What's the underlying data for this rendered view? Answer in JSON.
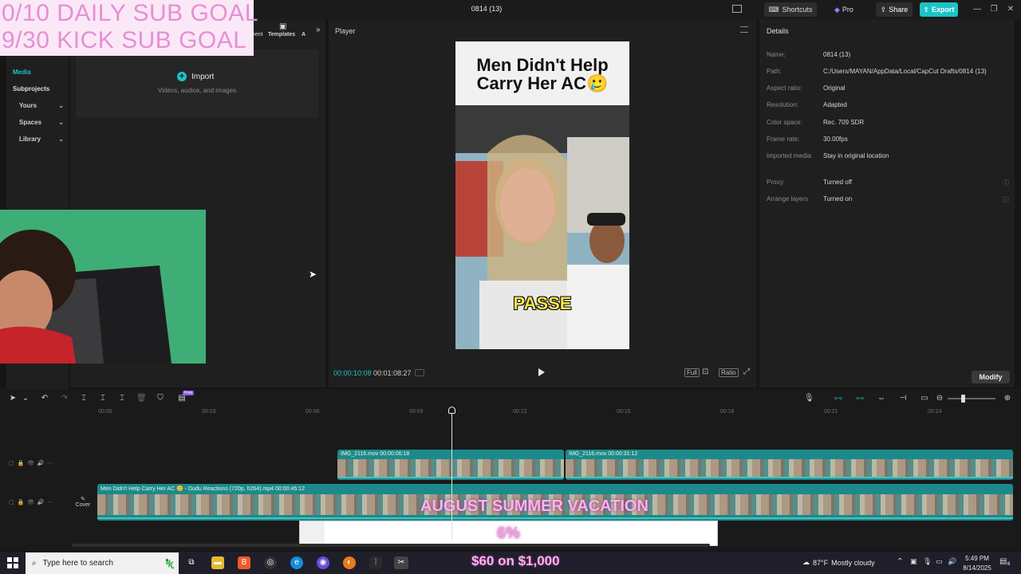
{
  "window": {
    "title": "0814 (13)",
    "shortcuts_label": "Shortcuts",
    "pro_label": "Pro",
    "share_label": "Share",
    "export_label": "Export"
  },
  "overlay": {
    "daily_goal": "0/10 DAILY SUB GOAL",
    "kick_goal": "9/30 KICK SUB GOAL",
    "event_title": "AUGUST SUMMER VACATION",
    "progress_percent": 6,
    "progress_text": "6%",
    "money_goal": "$60 on $1,000"
  },
  "left_nav": {
    "items": [
      {
        "label": "Media"
      },
      {
        "label": "Subprojects"
      }
    ],
    "dropdowns": [
      {
        "label": "Yours"
      },
      {
        "label": "Spaces"
      },
      {
        "label": "Library"
      }
    ]
  },
  "panel_tabs": {
    "partial_tab": "ment",
    "templates": "Templates",
    "partial_a": "A"
  },
  "import": {
    "label": "Import",
    "subtitle": "Videos, audios, and images"
  },
  "player": {
    "title": "Player",
    "video_title": "Men Didn't Help Carry Her AC🥲",
    "caption": "PASSE",
    "time_current": "00:00:10:08",
    "time_total": "00:01:08:27",
    "full_label": "Full",
    "ratio_label": "Ratio"
  },
  "details": {
    "title": "Details",
    "rows": [
      {
        "label": "Name:",
        "value": "0814 (13)"
      },
      {
        "label": "Path:",
        "value": "C:/Users/MAYAN/AppData/Local/CapCut Drafts/0814 (13)"
      },
      {
        "label": "Aspect ratio:",
        "value": "Original"
      },
      {
        "label": "Resolution:",
        "value": "Adapted"
      },
      {
        "label": "Color space:",
        "value": "Rec. 709 SDR"
      },
      {
        "label": "Frame rate:",
        "value": "30.00fps"
      },
      {
        "label": "Imported media:",
        "value": "Stay in original location"
      },
      {
        "label": "Proxy:",
        "value": "Turned off"
      },
      {
        "label": "Arrange layers",
        "value": "Turned on"
      }
    ],
    "modify_label": "Modify"
  },
  "timeline": {
    "ruler_ticks": [
      "00:00",
      "00:03",
      "00:06",
      "00:09",
      "00:12",
      "00:15",
      "00:18",
      "00:21",
      "00:24"
    ],
    "clips_upper": [
      {
        "label": "IMG_2116.mov   00:00:06:18"
      },
      {
        "label": "IMG_2116.mov   00:00:31:12"
      }
    ],
    "clip_main": {
      "label": "Men Didn't Help Carry Her AC 🥲 - Dudu Reactions (720p, h264).mp4   00:00:45:12"
    },
    "cover_label": "Cover",
    "free_badge": "Free"
  },
  "taskbar": {
    "search_placeholder": "Type here to search",
    "weather_temp": "87°F",
    "weather_desc": "Mostly cloudy",
    "time": "5:49 PM",
    "date": "8/14/2025",
    "notification_count": "6"
  },
  "colors": {
    "accent": "#1bc3c8",
    "clip": "#1c8a8a",
    "goal_pink": "#e58fd6"
  }
}
